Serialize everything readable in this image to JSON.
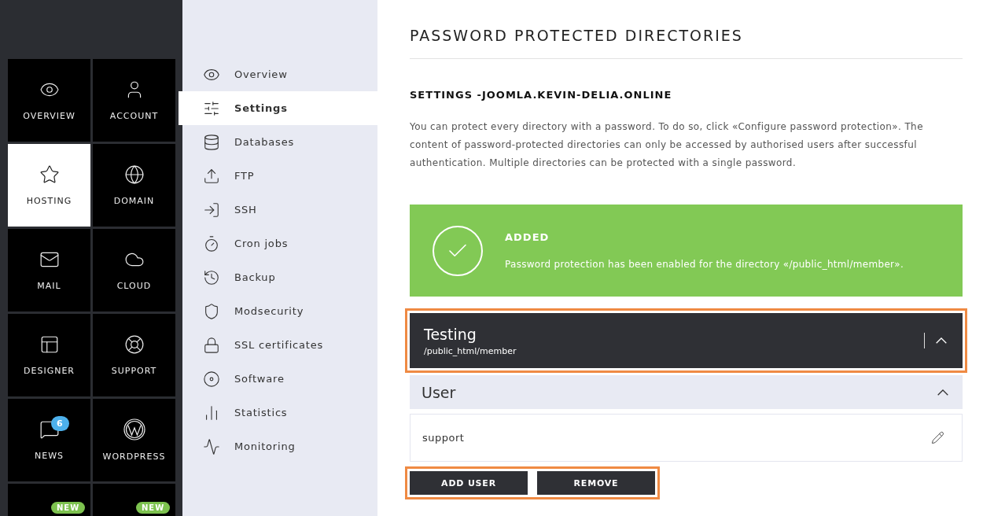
{
  "tiles": [
    {
      "label": "OVERVIEW",
      "selected": false
    },
    {
      "label": "ACCOUNT",
      "selected": false
    },
    {
      "label": "HOSTING",
      "selected": true
    },
    {
      "label": "DOMAIN",
      "selected": false
    },
    {
      "label": "MAIL",
      "selected": false
    },
    {
      "label": "CLOUD",
      "selected": false
    },
    {
      "label": "DESIGNER",
      "selected": false
    },
    {
      "label": "SUPPORT",
      "selected": false
    },
    {
      "label": "NEWS",
      "selected": false,
      "badge": {
        "text": "6",
        "kind": "count"
      }
    },
    {
      "label": "WORDPRESS",
      "selected": false
    },
    {
      "selected": false,
      "badge": {
        "text": "NEW",
        "kind": "new"
      }
    },
    {
      "selected": false,
      "badge": {
        "text": "NEW",
        "kind": "new"
      }
    }
  ],
  "submenu": [
    {
      "label": "Overview",
      "selected": false
    },
    {
      "label": "Settings",
      "selected": true
    },
    {
      "label": "Databases",
      "selected": false
    },
    {
      "label": "FTP",
      "selected": false
    },
    {
      "label": "SSH",
      "selected": false
    },
    {
      "label": "Cron jobs",
      "selected": false
    },
    {
      "label": "Backup",
      "selected": false
    },
    {
      "label": "Modsecurity",
      "selected": false
    },
    {
      "label": "SSL certificates",
      "selected": false
    },
    {
      "label": "Software",
      "selected": false
    },
    {
      "label": "Statistics",
      "selected": false
    },
    {
      "label": "Monitoring",
      "selected": false
    }
  ],
  "main": {
    "title": "PASSWORD PROTECTED DIRECTORIES",
    "subtitle": "SETTINGS -JOOMLA.KEVIN-DELIA.ONLINE",
    "description": "You can protect every directory with a password. To do so, click «Configure password protection». The content of password-protected directories can only be accessed by authorised users after successful authentication. Multiple directories can be protected with a single password.",
    "alert": {
      "title": "ADDED",
      "message": "Password protection has been enabled for the directory «/public_html/member»."
    },
    "directory": {
      "name": "Testing",
      "path": "/public_html/member",
      "expanded": true,
      "highlighted": true
    },
    "users_section": {
      "title": "User",
      "expanded": true,
      "users": [
        "support"
      ]
    },
    "actions": {
      "highlighted": true,
      "buttons": [
        "ADD USER",
        "REMOVE"
      ]
    }
  }
}
